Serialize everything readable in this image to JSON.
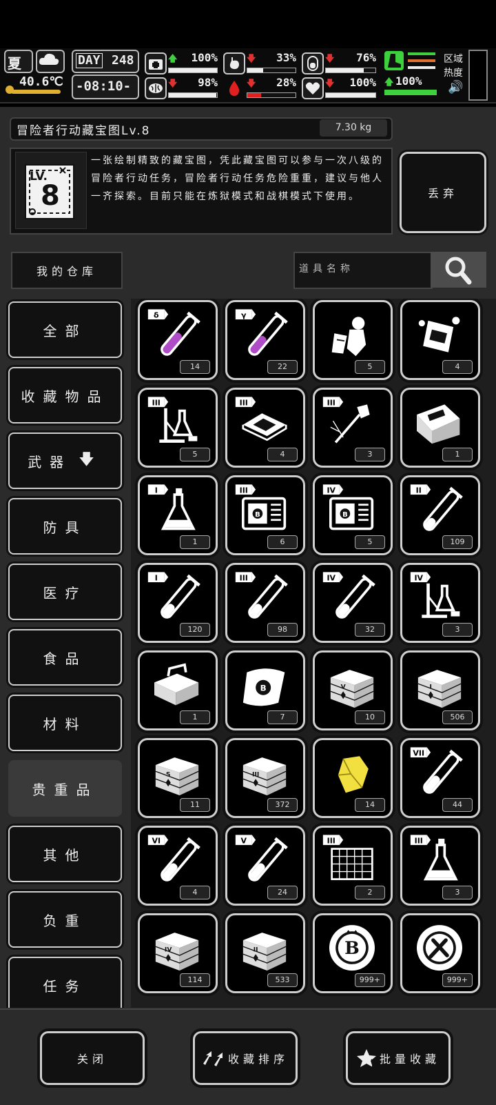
{
  "hud": {
    "season": "夏",
    "temperature": "40.6℃",
    "day_label": "DAY",
    "day_number": "248",
    "time": "-08:10-",
    "stats": [
      {
        "icon": "medkit-icon",
        "dir": "up",
        "value": "100%",
        "level": 1.0
      },
      {
        "icon": "stomach-icon",
        "dir": "down",
        "value": "33%",
        "level": 0.33
      },
      {
        "icon": "energy-icon",
        "dir": "down",
        "value": "76%",
        "level": 0.76
      },
      {
        "icon": "brain-icon",
        "dir": "down",
        "value": "98%",
        "level": 0.98
      },
      {
        "icon": "blood-drop-icon",
        "dir": "down",
        "value": "28%",
        "level": 0.28
      },
      {
        "icon": "heart-icon",
        "dir": "down",
        "value": "100%",
        "level": 1.0
      }
    ],
    "stamina": {
      "dir": "up",
      "value": "100%",
      "level": 1.0
    },
    "area_heat_label": "区域\n热度"
  },
  "item": {
    "name": "冒险者行动藏宝图Lv.8",
    "weight": "7.30 kg",
    "level_badge_top": "LV.",
    "level_badge_num": "8",
    "description": "一张绘制精致的藏宝图，凭此藏宝图可以参与一次八级的冒险者行动任务，冒险者行动任务危险重重，建议与他人一齐探索。目前只能在炼狱模式和战棋模式下使用。",
    "discard_label": "丢弃"
  },
  "warehouse": {
    "tab_label": "我的仓库",
    "search_placeholder": "道具名称"
  },
  "categories": [
    {
      "label": "全部",
      "active": false
    },
    {
      "label": "收藏物品",
      "active": false
    },
    {
      "label": "武器",
      "active": false,
      "sort_arrow": "🡇"
    },
    {
      "label": "防具",
      "active": false
    },
    {
      "label": "医疗",
      "active": false
    },
    {
      "label": "食品",
      "active": false
    },
    {
      "label": "材料",
      "active": false
    },
    {
      "label": "贵重品",
      "active": true
    },
    {
      "label": "其他",
      "active": false
    },
    {
      "label": "负重",
      "active": false
    },
    {
      "label": "任务",
      "active": false
    }
  ],
  "items": [
    {
      "kind": "tube",
      "tag": "δ",
      "count": "14",
      "liquid": "#b04cc8",
      "fill": 0.55
    },
    {
      "kind": "tube",
      "tag": "γ",
      "count": "22",
      "liquid": "#b04cc8",
      "fill": 0.45
    },
    {
      "kind": "astronaut",
      "count": "5"
    },
    {
      "kind": "robot",
      "count": "4"
    },
    {
      "kind": "lab",
      "tag": "III",
      "count": "5"
    },
    {
      "kind": "chip",
      "tag": "III",
      "count": "4"
    },
    {
      "kind": "wand",
      "tag": "III",
      "count": "3"
    },
    {
      "kind": "crate",
      "count": "1"
    },
    {
      "kind": "flask",
      "tag": "I",
      "count": "1"
    },
    {
      "kind": "machine",
      "tag": "III",
      "count": "6"
    },
    {
      "kind": "machine",
      "tag": "IV",
      "count": "5"
    },
    {
      "kind": "tube",
      "tag": "II",
      "count": "109",
      "liquid": "#ffffff",
      "fill": 0.25
    },
    {
      "kind": "tube",
      "tag": "I",
      "count": "120",
      "liquid": "#ffffff",
      "fill": 0.3
    },
    {
      "kind": "tube",
      "tag": "III",
      "count": "98",
      "liquid": "#ffffff",
      "fill": 0.3
    },
    {
      "kind": "tube",
      "tag": "IV",
      "count": "32",
      "liquid": "#ffffff",
      "fill": 0.3
    },
    {
      "kind": "lab",
      "tag": "IV",
      "count": "3"
    },
    {
      "kind": "toolbox",
      "count": "1"
    },
    {
      "kind": "scroll",
      "count": "7"
    },
    {
      "kind": "chest",
      "tag": "V",
      "count": "10"
    },
    {
      "kind": "chest",
      "tag": "I",
      "count": "506"
    },
    {
      "kind": "chest",
      "tag": "S",
      "count": "11"
    },
    {
      "kind": "chest",
      "tag": "III",
      "count": "372"
    },
    {
      "kind": "gem",
      "count": "14"
    },
    {
      "kind": "tube",
      "tag": "VII",
      "count": "44",
      "liquid": "#ffffff",
      "fill": 0.4
    },
    {
      "kind": "tube",
      "tag": "VI",
      "count": "4",
      "liquid": "#ffffff",
      "fill": 0.4
    },
    {
      "kind": "tube",
      "tag": "V",
      "count": "24",
      "liquid": "#ffffff",
      "fill": 0.4
    },
    {
      "kind": "grid",
      "tag": "III",
      "count": "2"
    },
    {
      "kind": "flask",
      "tag": "III",
      "count": "3"
    },
    {
      "kind": "chest",
      "tag": "IV",
      "count": "114"
    },
    {
      "kind": "chest",
      "tag": "II",
      "count": "533"
    },
    {
      "kind": "coin-b",
      "count": "999+"
    },
    {
      "kind": "coin-wrench",
      "count": "999+"
    }
  ],
  "bottom": {
    "close_label": "关闭",
    "sort_label": "收藏排序",
    "batch_label": "批量收藏"
  }
}
